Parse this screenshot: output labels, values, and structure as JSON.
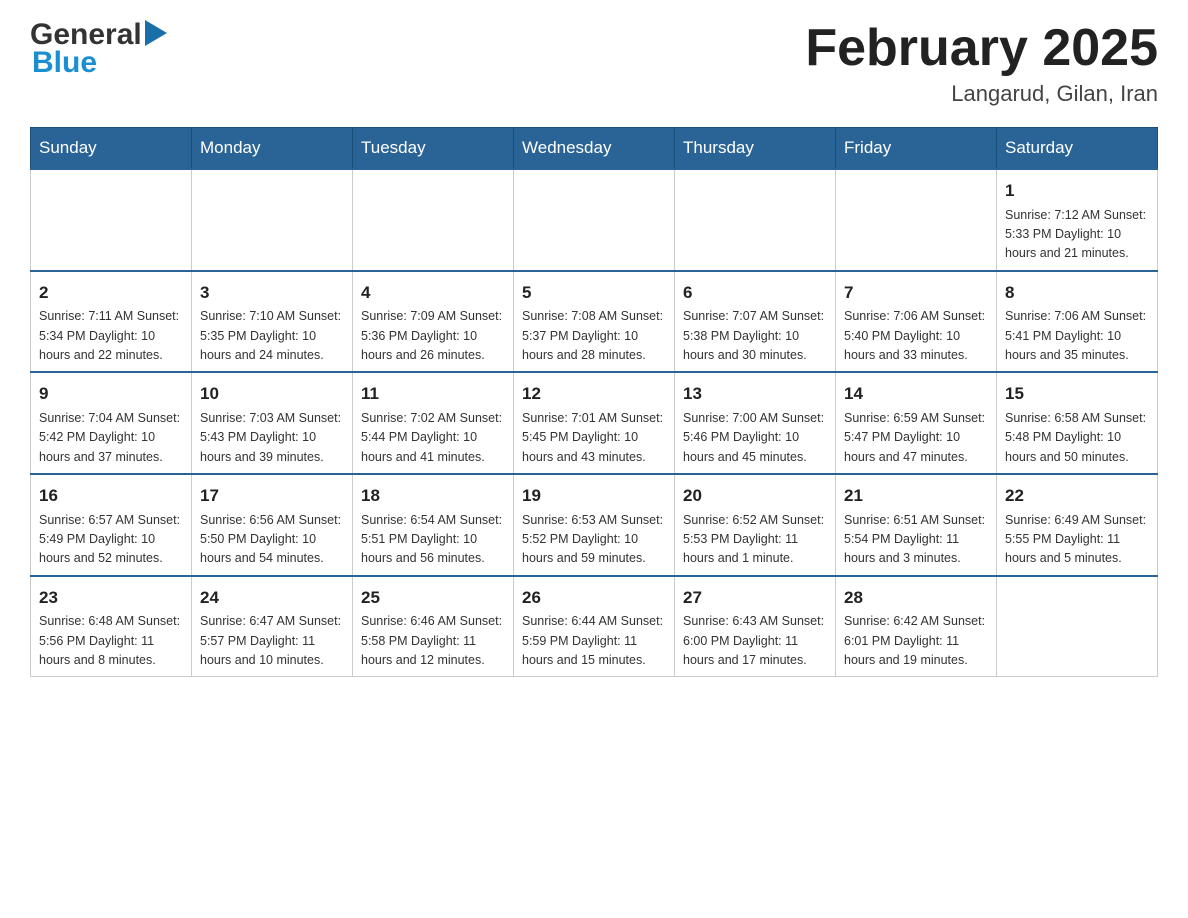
{
  "header": {
    "month_title": "February 2025",
    "location": "Langarud, Gilan, Iran",
    "logo_general": "General",
    "logo_blue": "Blue"
  },
  "days_of_week": [
    "Sunday",
    "Monday",
    "Tuesday",
    "Wednesday",
    "Thursday",
    "Friday",
    "Saturday"
  ],
  "weeks": [
    {
      "days": [
        {
          "number": "",
          "info": ""
        },
        {
          "number": "",
          "info": ""
        },
        {
          "number": "",
          "info": ""
        },
        {
          "number": "",
          "info": ""
        },
        {
          "number": "",
          "info": ""
        },
        {
          "number": "",
          "info": ""
        },
        {
          "number": "1",
          "info": "Sunrise: 7:12 AM\nSunset: 5:33 PM\nDaylight: 10 hours\nand 21 minutes."
        }
      ]
    },
    {
      "days": [
        {
          "number": "2",
          "info": "Sunrise: 7:11 AM\nSunset: 5:34 PM\nDaylight: 10 hours\nand 22 minutes."
        },
        {
          "number": "3",
          "info": "Sunrise: 7:10 AM\nSunset: 5:35 PM\nDaylight: 10 hours\nand 24 minutes."
        },
        {
          "number": "4",
          "info": "Sunrise: 7:09 AM\nSunset: 5:36 PM\nDaylight: 10 hours\nand 26 minutes."
        },
        {
          "number": "5",
          "info": "Sunrise: 7:08 AM\nSunset: 5:37 PM\nDaylight: 10 hours\nand 28 minutes."
        },
        {
          "number": "6",
          "info": "Sunrise: 7:07 AM\nSunset: 5:38 PM\nDaylight: 10 hours\nand 30 minutes."
        },
        {
          "number": "7",
          "info": "Sunrise: 7:06 AM\nSunset: 5:40 PM\nDaylight: 10 hours\nand 33 minutes."
        },
        {
          "number": "8",
          "info": "Sunrise: 7:06 AM\nSunset: 5:41 PM\nDaylight: 10 hours\nand 35 minutes."
        }
      ]
    },
    {
      "days": [
        {
          "number": "9",
          "info": "Sunrise: 7:04 AM\nSunset: 5:42 PM\nDaylight: 10 hours\nand 37 minutes."
        },
        {
          "number": "10",
          "info": "Sunrise: 7:03 AM\nSunset: 5:43 PM\nDaylight: 10 hours\nand 39 minutes."
        },
        {
          "number": "11",
          "info": "Sunrise: 7:02 AM\nSunset: 5:44 PM\nDaylight: 10 hours\nand 41 minutes."
        },
        {
          "number": "12",
          "info": "Sunrise: 7:01 AM\nSunset: 5:45 PM\nDaylight: 10 hours\nand 43 minutes."
        },
        {
          "number": "13",
          "info": "Sunrise: 7:00 AM\nSunset: 5:46 PM\nDaylight: 10 hours\nand 45 minutes."
        },
        {
          "number": "14",
          "info": "Sunrise: 6:59 AM\nSunset: 5:47 PM\nDaylight: 10 hours\nand 47 minutes."
        },
        {
          "number": "15",
          "info": "Sunrise: 6:58 AM\nSunset: 5:48 PM\nDaylight: 10 hours\nand 50 minutes."
        }
      ]
    },
    {
      "days": [
        {
          "number": "16",
          "info": "Sunrise: 6:57 AM\nSunset: 5:49 PM\nDaylight: 10 hours\nand 52 minutes."
        },
        {
          "number": "17",
          "info": "Sunrise: 6:56 AM\nSunset: 5:50 PM\nDaylight: 10 hours\nand 54 minutes."
        },
        {
          "number": "18",
          "info": "Sunrise: 6:54 AM\nSunset: 5:51 PM\nDaylight: 10 hours\nand 56 minutes."
        },
        {
          "number": "19",
          "info": "Sunrise: 6:53 AM\nSunset: 5:52 PM\nDaylight: 10 hours\nand 59 minutes."
        },
        {
          "number": "20",
          "info": "Sunrise: 6:52 AM\nSunset: 5:53 PM\nDaylight: 11 hours\nand 1 minute."
        },
        {
          "number": "21",
          "info": "Sunrise: 6:51 AM\nSunset: 5:54 PM\nDaylight: 11 hours\nand 3 minutes."
        },
        {
          "number": "22",
          "info": "Sunrise: 6:49 AM\nSunset: 5:55 PM\nDaylight: 11 hours\nand 5 minutes."
        }
      ]
    },
    {
      "days": [
        {
          "number": "23",
          "info": "Sunrise: 6:48 AM\nSunset: 5:56 PM\nDaylight: 11 hours\nand 8 minutes."
        },
        {
          "number": "24",
          "info": "Sunrise: 6:47 AM\nSunset: 5:57 PM\nDaylight: 11 hours\nand 10 minutes."
        },
        {
          "number": "25",
          "info": "Sunrise: 6:46 AM\nSunset: 5:58 PM\nDaylight: 11 hours\nand 12 minutes."
        },
        {
          "number": "26",
          "info": "Sunrise: 6:44 AM\nSunset: 5:59 PM\nDaylight: 11 hours\nand 15 minutes."
        },
        {
          "number": "27",
          "info": "Sunrise: 6:43 AM\nSunset: 6:00 PM\nDaylight: 11 hours\nand 17 minutes."
        },
        {
          "number": "28",
          "info": "Sunrise: 6:42 AM\nSunset: 6:01 PM\nDaylight: 11 hours\nand 19 minutes."
        },
        {
          "number": "",
          "info": ""
        }
      ]
    }
  ]
}
